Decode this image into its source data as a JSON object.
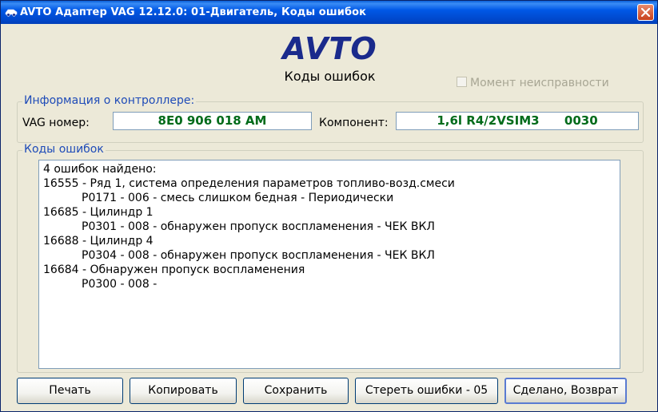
{
  "window": {
    "title": "AVTO Адаптер VAG 12.12.0: 01-Двигатель,  Коды ошибок"
  },
  "header": {
    "logo": "AVTO",
    "subtitle": "Коды ошибок"
  },
  "fault_moment": {
    "label": "Момент неисправности",
    "checked": false,
    "enabled": false
  },
  "controller": {
    "legend": "Информация о контроллере:",
    "vag_label": "VAG номер:",
    "vag_value": "8E0 906 018 AM",
    "component_label": "Компонент:",
    "component_value": "1,6l R4/2VSIM3      0030"
  },
  "codes": {
    "legend": "Коды ошибок",
    "lines": [
      "4 ошибок найдено:",
      "16555 - Ряд 1, система определения параметров топливо-возд.смеси",
      "P0171 - 006 - смесь слишком бедная - Периодически",
      "16685 - Цилиндр 1",
      "P0301 - 008 - обнаружен пропуск воспламенения - ЧЕК ВКЛ",
      "16688 - Цилиндр 4",
      "P0304 - 008 - обнаружен пропуск воспламенения - ЧЕК ВКЛ",
      "16684 - Обнаружен пропуск воспламенения",
      "P0300 - 008 -"
    ]
  },
  "buttons": {
    "print": "Печать",
    "copy": "Копировать",
    "save": "Сохранить",
    "clear": "Стереть ошибки - 05",
    "done": "Сделано, Возврат"
  }
}
